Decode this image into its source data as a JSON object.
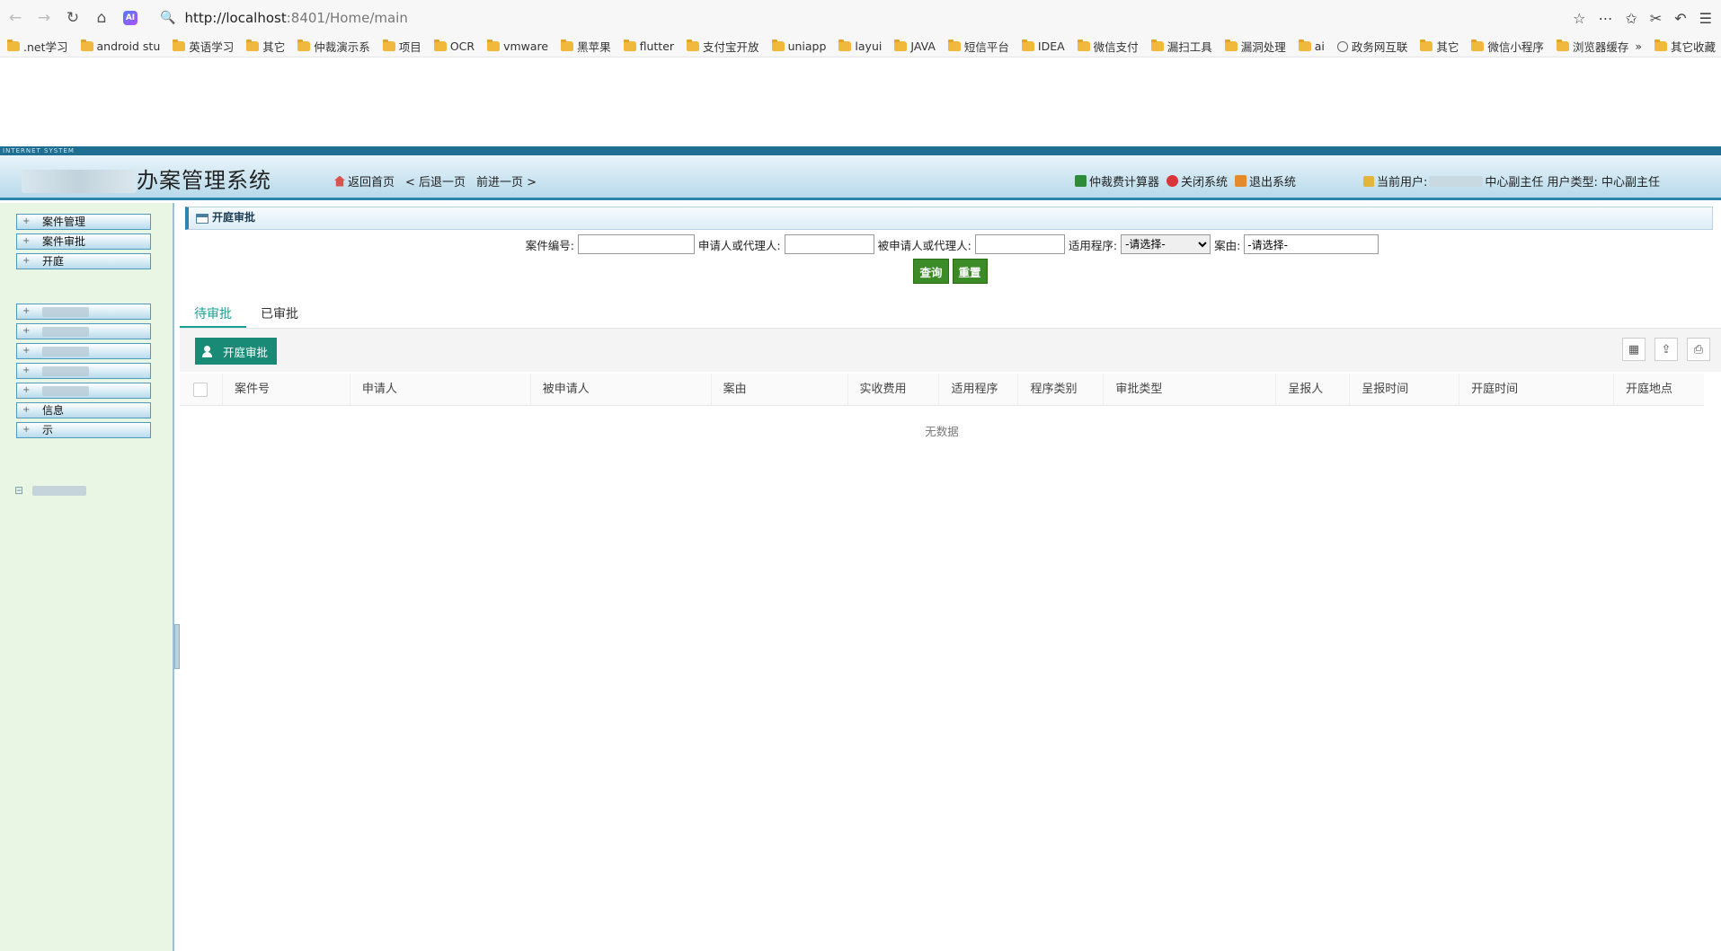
{
  "browser": {
    "url_host": "http://localhost",
    "url_rest": ":8401/Home/main",
    "ai_label": "AI",
    "bookmarks": [
      ".net学习",
      "android stu",
      "英语学习",
      "其它",
      "仲裁演示系",
      "项目",
      "OCR",
      "vmware",
      "黑苹果",
      "flutter",
      "支付宝开放",
      "uniapp",
      "layui",
      "JAVA",
      "短信平台",
      "IDEA",
      "微信支付",
      "漏扫工具",
      "漏洞处理",
      "ai",
      "政务网互联",
      "其它",
      "微信小程序",
      "浏览器缓存"
    ],
    "overflow": "»",
    "other_bookmarks": "其它收藏"
  },
  "app": {
    "strip": "INTERNET SYSTEM",
    "title_visible": "办案管理系统",
    "title_prefix": "仲裁",
    "nav": {
      "home": "返回首页",
      "back": "< 后退一页",
      "forward": "前进一页 >"
    },
    "tools": {
      "calculator": "仲裁费计算器",
      "close": "关闭系统",
      "logout": "退出系统"
    },
    "user": {
      "current_label": "当前用户:",
      "role_text": "中心副主任 用户类型: 中心副主任"
    }
  },
  "sidebar": {
    "items": [
      {
        "label": "案件管理"
      },
      {
        "label": "案件审批"
      },
      {
        "label": "开庭"
      },
      {
        "label": ""
      },
      {
        "label": ""
      },
      {
        "label": ""
      },
      {
        "label": ""
      },
      {
        "label": ""
      },
      {
        "label": "信息"
      },
      {
        "label": "示"
      }
    ]
  },
  "panel": {
    "title": "开庭审批"
  },
  "search": {
    "case_no_label": "案件编号:",
    "applicant_label": "申请人或代理人:",
    "respondent_label": "被申请人或代理人:",
    "procedure_label": "适用程序:",
    "procedure_value": "-请选择-",
    "cause_label": "案由:",
    "cause_value": "-请选择-",
    "query": "查询",
    "reset": "重置"
  },
  "tabs": [
    {
      "label": "待审批"
    },
    {
      "label": "已审批"
    }
  ],
  "toolbar": {
    "approve": "开庭审批"
  },
  "table": {
    "columns": [
      "案件号",
      "申请人",
      "被申请人",
      "案由",
      "实收费用",
      "适用程序",
      "程序类别",
      "审批类型",
      "呈报人",
      "呈报时间",
      "开庭时间",
      "开庭地点"
    ],
    "empty": "无数据"
  }
}
